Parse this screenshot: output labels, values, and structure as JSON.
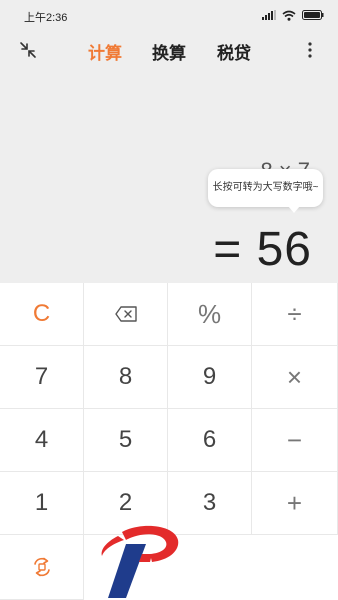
{
  "status_bar": {
    "time": "上午2:36"
  },
  "tabs": [
    {
      "label": "计算",
      "active": true
    },
    {
      "label": "换算",
      "active": false
    },
    {
      "label": "税贷",
      "active": false
    }
  ],
  "display": {
    "expression": "8 × 7",
    "result": "= 56",
    "tooltip": "长按可转为大写数字哦~"
  },
  "keys": {
    "clear": "C",
    "backspace": "backspace-icon",
    "percent": "%",
    "divide": "÷",
    "seven": "7",
    "eight": "8",
    "nine": "9",
    "multiply": "×",
    "four": "4",
    "five": "5",
    "six": "6",
    "minus": "−",
    "one": "1",
    "two": "2",
    "three": "3",
    "plus": "+",
    "switch": "swap-icon"
  },
  "colors": {
    "accent": "#f07a35",
    "display_bg": "#eeeeee",
    "logo_red": "#e32b2b",
    "logo_blue": "#1f3c8c"
  }
}
